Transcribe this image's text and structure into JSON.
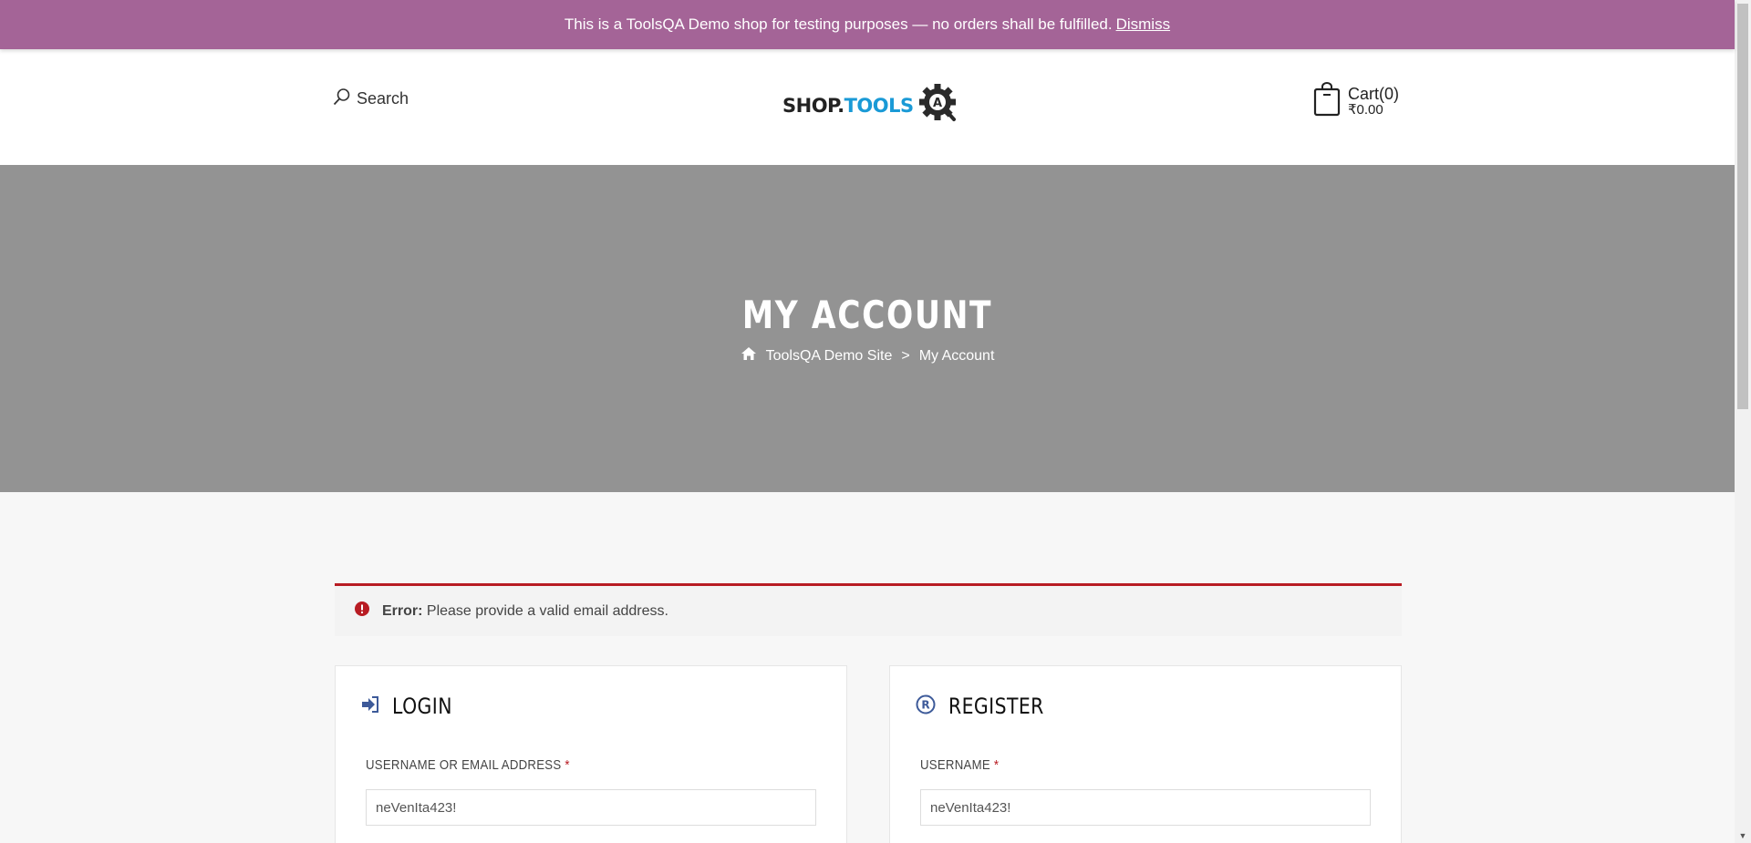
{
  "store_notice": {
    "message": "This is a ToolsQA Demo shop for testing purposes — no orders shall be fulfilled.",
    "dismiss_label": "Dismiss"
  },
  "header": {
    "search_label": "Search",
    "logo": {
      "part1": "SHOP.",
      "part2": "TOOLS",
      "badge": "A"
    },
    "cart": {
      "label": "Cart(0)",
      "total": "₹0.00"
    }
  },
  "hero": {
    "title": "MY ACCOUNT",
    "breadcrumb": {
      "home": "ToolsQA Demo Site",
      "separator": ">",
      "current": "My Account"
    }
  },
  "error": {
    "prefix": "Error:",
    "message": "Please provide a valid email address."
  },
  "login": {
    "title": "LOGIN",
    "field_label": "USERNAME OR EMAIL ADDRESS",
    "required_mark": "*",
    "field_value": "neVenIta423!"
  },
  "register": {
    "title": "REGISTER",
    "field_label": "USERNAME",
    "required_mark": "*",
    "field_value": "neVenIta423!"
  },
  "colors": {
    "notice_bg": "#a46497",
    "error_accent": "#b81c23",
    "hero_bg": "#939393",
    "icon_blue": "#3d5a99"
  }
}
